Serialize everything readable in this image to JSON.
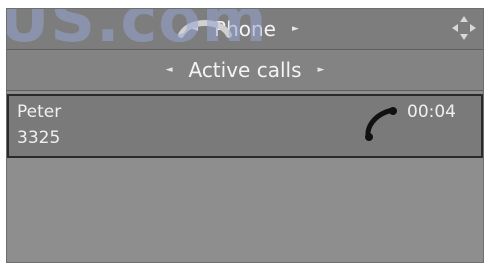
{
  "watermark": "US.com",
  "header": {
    "title": "Phone",
    "prev_arrow": "◄",
    "next_arrow": "►"
  },
  "subheader": {
    "title": "Active calls",
    "prev_arrow": "◄",
    "next_arrow": "►"
  },
  "active_call": {
    "name": "Peter",
    "number": "3325",
    "duration": "00:04"
  },
  "icons": {
    "header": "phone-handset-icon",
    "corner": "move-arrows-icon",
    "call": "handset-icon"
  },
  "colors": {
    "background": "#8e8e8e",
    "bar": "#7d7d7d",
    "row_border": "#2a2a2a",
    "text": "#f0f0f0"
  }
}
